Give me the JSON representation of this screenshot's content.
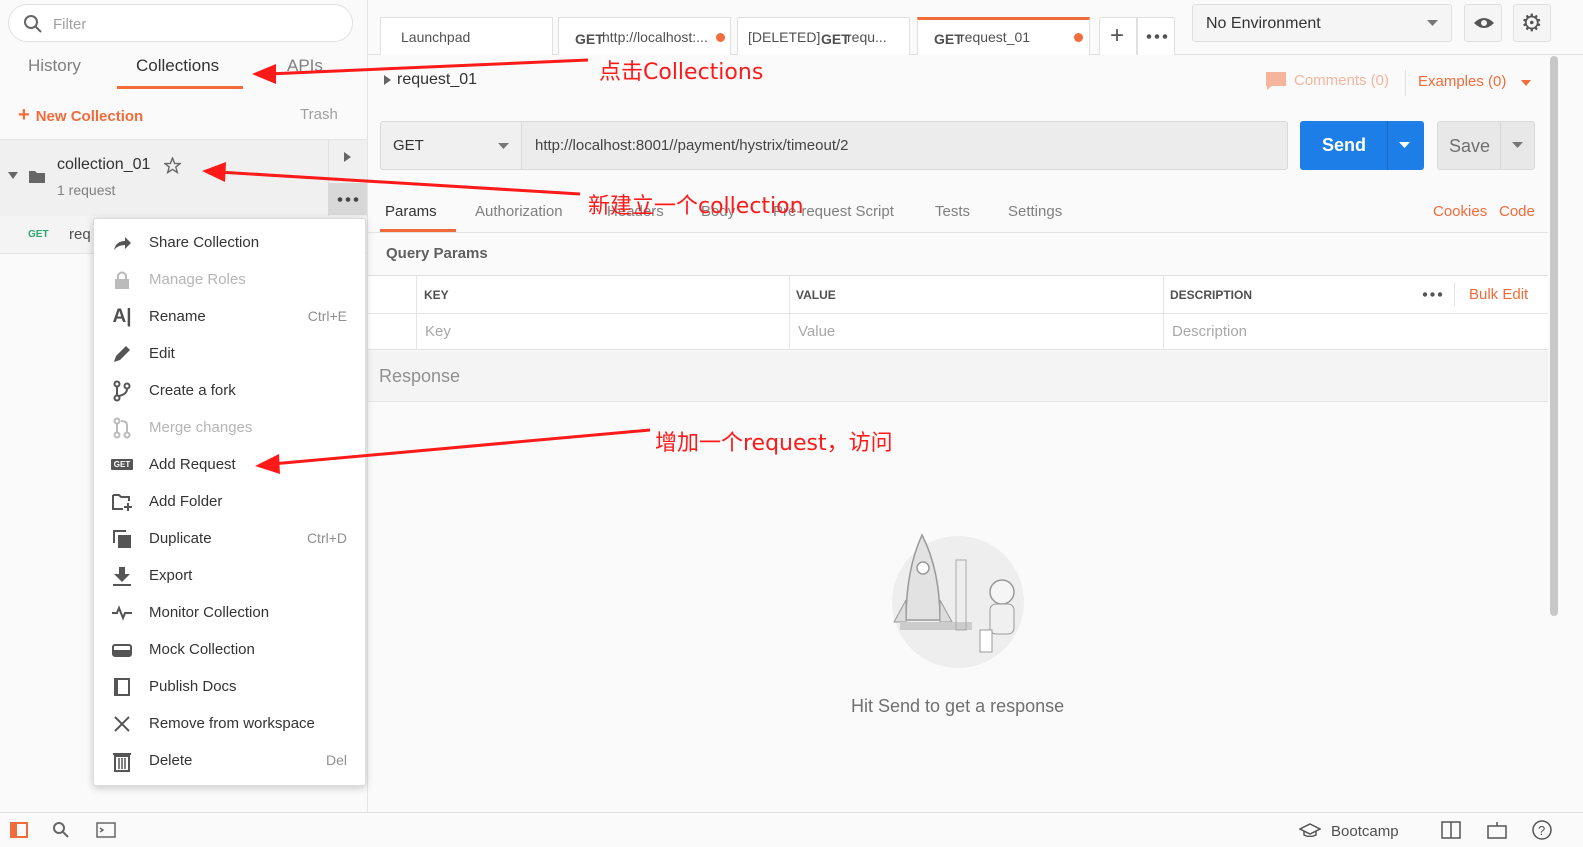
{
  "sidebar": {
    "filter_placeholder": "Filter",
    "tabs": [
      "History",
      "Collections",
      "APIs"
    ],
    "new_collection": "New Collection",
    "trash": "Trash",
    "collection": {
      "name": "collection_01",
      "count": "1 request"
    },
    "request": {
      "method": "GET",
      "name": "req"
    }
  },
  "context_menu": [
    {
      "label": "Share Collection",
      "icon": "share-icon",
      "shortcut": ""
    },
    {
      "label": "Manage Roles",
      "icon": "lock-icon",
      "shortcut": "",
      "disabled": true
    },
    {
      "label": "Rename",
      "icon": "rename-icon",
      "shortcut": "Ctrl+E"
    },
    {
      "label": "Edit",
      "icon": "pencil-icon",
      "shortcut": ""
    },
    {
      "label": "Create a fork",
      "icon": "fork-icon",
      "shortcut": ""
    },
    {
      "label": "Merge changes",
      "icon": "merge-icon",
      "shortcut": "",
      "disabled": true
    },
    {
      "label": "Add Request",
      "icon": "get-icon",
      "shortcut": ""
    },
    {
      "label": "Add Folder",
      "icon": "folder-add-icon",
      "shortcut": ""
    },
    {
      "label": "Duplicate",
      "icon": "duplicate-icon",
      "shortcut": "Ctrl+D"
    },
    {
      "label": "Export",
      "icon": "download-icon",
      "shortcut": ""
    },
    {
      "label": "Monitor Collection",
      "icon": "monitor-icon",
      "shortcut": ""
    },
    {
      "label": "Mock Collection",
      "icon": "server-icon",
      "shortcut": ""
    },
    {
      "label": "Publish Docs",
      "icon": "docs-icon",
      "shortcut": ""
    },
    {
      "label": "Remove from workspace",
      "icon": "close-icon",
      "shortcut": ""
    },
    {
      "label": "Delete",
      "icon": "trash-icon",
      "shortcut": "Del"
    }
  ],
  "tabs": [
    {
      "label": "Launchpad",
      "method": ""
    },
    {
      "label": "http://localhost:...",
      "method": "GET"
    },
    {
      "label": "[DELETED]",
      "method": "GET",
      "suffix": "requ..."
    },
    {
      "label": "request_01",
      "method": "GET"
    }
  ],
  "environment": "No Environment",
  "request": {
    "name": "request_01",
    "comments": "Comments (0)",
    "examples": "Examples (0)",
    "method": "GET",
    "url": "http://localhost:8001//payment/hystrix/timeout/2",
    "send": "Send",
    "save": "Save"
  },
  "subtabs": [
    "Params",
    "Authorization",
    "Headers",
    "Body",
    "Pre-request Script",
    "Tests",
    "Settings"
  ],
  "subtab_links": {
    "cookies": "Cookies",
    "code": "Code"
  },
  "query_params": {
    "title": "Query Params",
    "headers": [
      "KEY",
      "VALUE",
      "DESCRIPTION"
    ],
    "bulk_edit": "Bulk Edit",
    "placeholders": [
      "Key",
      "Value",
      "Description"
    ]
  },
  "response": {
    "title": "Response",
    "empty": "Hit Send to get a response"
  },
  "footer": {
    "bootcamp": "Bootcamp"
  },
  "annotations": {
    "collections": "点击Collections",
    "new_collection": "新建立一个collection",
    "add_request": "增加一个request，访问"
  },
  "colors": {
    "accent": "#f26b3a",
    "send": "#1e7ee8",
    "get": "#2aa870",
    "annotation": "#ff1a1a"
  }
}
